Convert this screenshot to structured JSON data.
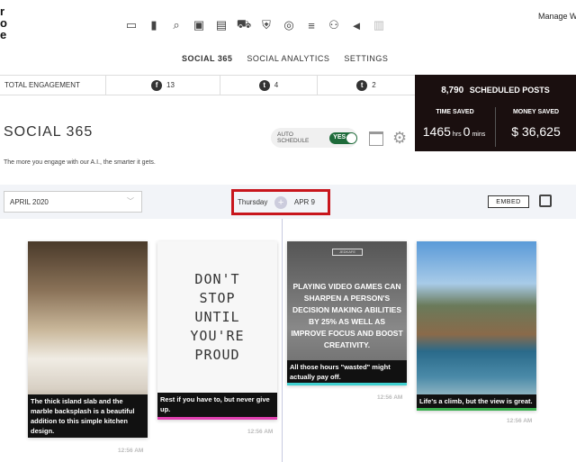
{
  "logo": {
    "lines": [
      "r",
      "o",
      "e"
    ]
  },
  "topnav": {
    "icons": [
      "window-icon",
      "bar-chart-icon",
      "search-icon",
      "id-card-icon",
      "calendar-icon",
      "cart-icon",
      "shield-icon",
      "target-icon",
      "align-center-icon",
      "users-icon",
      "megaphone-icon",
      "building-icon"
    ]
  },
  "header": {
    "manage": "Manage We"
  },
  "subnav": {
    "items": [
      "SOCIAL 365",
      "SOCIAL ANALYTICS",
      "SETTINGS"
    ]
  },
  "engagement": {
    "label": "TOTAL ENGAGEMENT",
    "facebook": "13",
    "twitter": "4",
    "tumblr": "2"
  },
  "stats": {
    "scheduled_count": "8,790",
    "scheduled_label": "SCHEDULED POSTS",
    "time_saved_label": "TIME SAVED",
    "time_hrs": "1465",
    "hrs_unit": "hrs",
    "time_mins": "0",
    "mins_unit": "mins",
    "money_saved_label": "MONEY SAVED",
    "money": "$ 36,625"
  },
  "page": {
    "title": "SOCIAL 365",
    "subtitle": "The more you engage with our A.I., the smarter it gets.",
    "auto_schedule_label": "AUTO SCHEDULE",
    "auto_schedule_value": "YES"
  },
  "datebar": {
    "month": "APRIL 2020",
    "day": "Thursday",
    "date": "APR 9",
    "embed": "EMBED"
  },
  "cards": [
    {
      "caption": "The thick island slab and the marble backsplash is a beautiful addition to this simple kitchen design.",
      "time": "12:56 AM"
    },
    {
      "quote": [
        "DON'T",
        "STOP",
        "UNTIL",
        "YOU'RE",
        "PROUD"
      ],
      "caption": "Rest if you have to, but never give up.",
      "time": "12:56 AM"
    },
    {
      "logo": "JEDKAFE",
      "overlay": "PLAYING VIDEO GAMES CAN SHARPEN A PERSON'S DECISION MAKING ABILITIES BY 25% AS WELL AS IMPROVE FOCUS AND BOOST CREATIVITY.",
      "caption": "All those hours \"wasted\" might actually pay off.",
      "time": "12:56 AM"
    },
    {
      "caption": "Life's a climb, but the view is great.",
      "time": "12:56 AM"
    }
  ],
  "colors": {
    "panel": "#1a0f0f",
    "toggle": "#1e6b3a",
    "highlight": "#c8161d"
  }
}
